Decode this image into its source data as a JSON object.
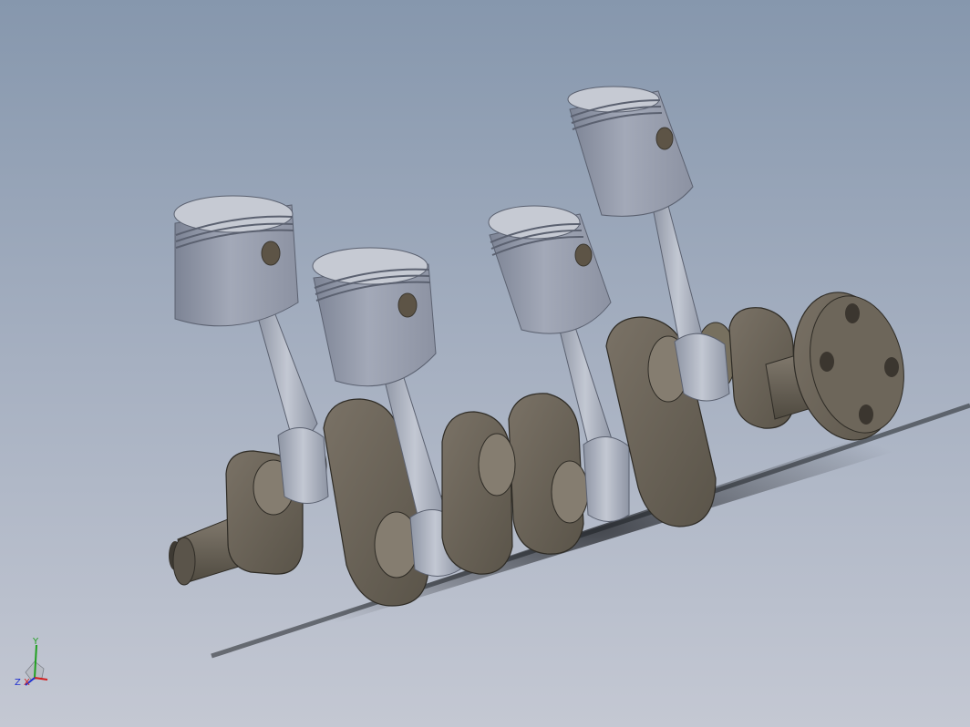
{
  "viewport": {
    "model": "inline-four-crankshaft-assembly",
    "components": {
      "pistons": 4,
      "connecting_rods": 4,
      "crank_webs": 4,
      "flywheel_flange_holes": 4
    }
  },
  "triad": {
    "x_label": "X",
    "y_label": "Y",
    "z_label": "Z",
    "x_color": "#d22020",
    "y_color": "#20a020",
    "z_color": "#2030d0"
  },
  "colors": {
    "piston": "#8f96a6",
    "rod": "#a9b0bf",
    "metal": "#6e6659",
    "shadow": "#2a2c30"
  }
}
